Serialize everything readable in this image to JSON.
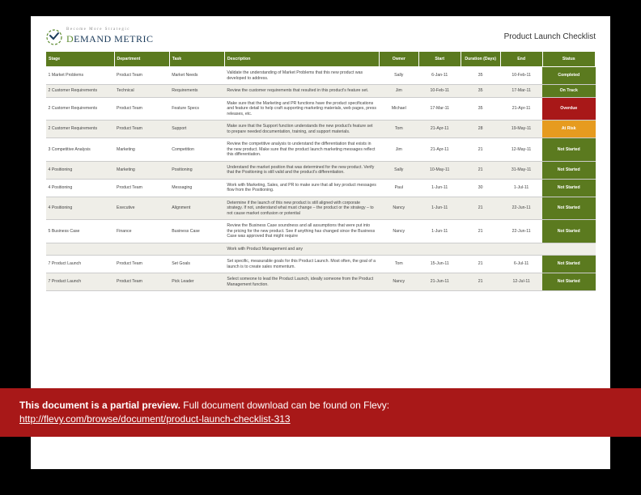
{
  "logo": {
    "tagline": "Become More Strategic",
    "brand_prefix": "D",
    "brand_rest": "EMAND METRIC"
  },
  "title": "Product Launch Checklist",
  "columns": [
    "Stage",
    "Department",
    "Task",
    "Description",
    "Owner",
    "Start",
    "Duration (Days)",
    "End",
    "Status"
  ],
  "rows": [
    {
      "stage": "1 Market Problems",
      "dept": "Product Team",
      "task": "Market Needs",
      "desc": "Validate the understanding of Market Problems that this new product was developed to address.",
      "owner": "Sally",
      "start": "6-Jan-11",
      "dur": "35",
      "end": "10-Feb-11",
      "status": "Completed",
      "scls": "completed"
    },
    {
      "stage": "2 Customer Requirements",
      "dept": "Technical",
      "task": "Requirements",
      "desc": "Review the customer requirements that resulted in this product's feature set.",
      "owner": "Jim",
      "start": "10-Feb-11",
      "dur": "35",
      "end": "17-Mar-11",
      "status": "On Track",
      "scls": "ontrack"
    },
    {
      "stage": "2 Customer Requirements",
      "dept": "Product Team",
      "task": "Feature Specs",
      "desc": "Make sure that the Marketing and PR functions have the product specifications and feature detail to help craft supporting marketing materials, web pages, press releases, etc.",
      "owner": "Michael",
      "start": "17-Mar-11",
      "dur": "35",
      "end": "21-Apr-11",
      "status": "Overdue",
      "scls": "overdue"
    },
    {
      "stage": "2 Customer Requirements",
      "dept": "Product Team",
      "task": "Support",
      "desc": "Make sure that the Support function understands the new product's feature set to prepare needed documentation, training, and support materials.",
      "owner": "Tom",
      "start": "21-Apr-11",
      "dur": "28",
      "end": "19-May-11",
      "status": "At Risk",
      "scls": "atrisk"
    },
    {
      "stage": "3 Competitive Analysis",
      "dept": "Marketing",
      "task": "Competition",
      "desc": "Review the competitive analysis to understand the differentiation that exists in the new product. Make sure that the product launch marketing messages reflect this differentiation.",
      "owner": "Jim",
      "start": "21-Apr-11",
      "dur": "21",
      "end": "12-May-11",
      "status": "Not Started",
      "scls": "notstarted"
    },
    {
      "stage": "4 Positioning",
      "dept": "Marketing",
      "task": "Positioning",
      "desc": "Understand the market position that was determined for the new product. Verify that the Positioning is still valid and the product's differentiation.",
      "owner": "Sally",
      "start": "10-May-11",
      "dur": "21",
      "end": "31-May-11",
      "status": "Not Started",
      "scls": "notstarted"
    },
    {
      "stage": "4 Positioning",
      "dept": "Product Team",
      "task": "Messaging",
      "desc": "Work with Marketing, Sales, and PR to make sure that all key product messages flow from the Positioning.",
      "owner": "Paul",
      "start": "1-Jun-11",
      "dur": "30",
      "end": "1-Jul-11",
      "status": "Not Started",
      "scls": "notstarted"
    },
    {
      "stage": "4 Positioning",
      "dept": "Executive",
      "task": "Alignment",
      "desc": "Determine if the launch of this new product is still aligned with corporate strategy. If not, understand what must change – the product or the strategy – to not cause market confusion or potential",
      "owner": "Nancy",
      "start": "1-Jun-11",
      "dur": "21",
      "end": "22-Jun-11",
      "status": "Not Started",
      "scls": "notstarted"
    },
    {
      "stage": "5 Business Case",
      "dept": "Finance",
      "task": "Business Case",
      "desc": "Review the Business Case soundness and all assumptions that were put into the pricing for the new product. See if anything has changed since the Business Case was approved that might require",
      "owner": "Nancy",
      "start": "1-Jun-11",
      "dur": "21",
      "end": "22-Jun-11",
      "status": "Not Started",
      "scls": "notstarted"
    },
    {
      "stage": "",
      "dept": "",
      "task": "",
      "desc": "Work with Product Management and any",
      "owner": "",
      "start": "",
      "dur": "",
      "end": "",
      "status": "",
      "scls": ""
    },
    {
      "stage": "7 Product Launch",
      "dept": "Product Team",
      "task": "Set Goals",
      "desc": "Set specific, measurable goals for this Product Launch. Most often, the goal of a launch is to create sales momentum.",
      "owner": "Tom",
      "start": "15-Jun-11",
      "dur": "21",
      "end": "6-Jul-11",
      "status": "Not Started",
      "scls": "notstarted"
    },
    {
      "stage": "7 Product Launch",
      "dept": "Product Team",
      "task": "Pick Leader",
      "desc": "Select someone to lead the Product Launch, ideally someone from the Product Management function.",
      "owner": "Nancy",
      "start": "21-Jun-11",
      "dur": "21",
      "end": "12-Jul-11",
      "status": "Not Started",
      "scls": "notstarted"
    }
  ],
  "banner": {
    "bold": "This document is a partial preview.",
    "rest": "  Full document download can be found on Flevy:",
    "link": "http://flevy.com/browse/document/product-launch-checklist-313"
  }
}
